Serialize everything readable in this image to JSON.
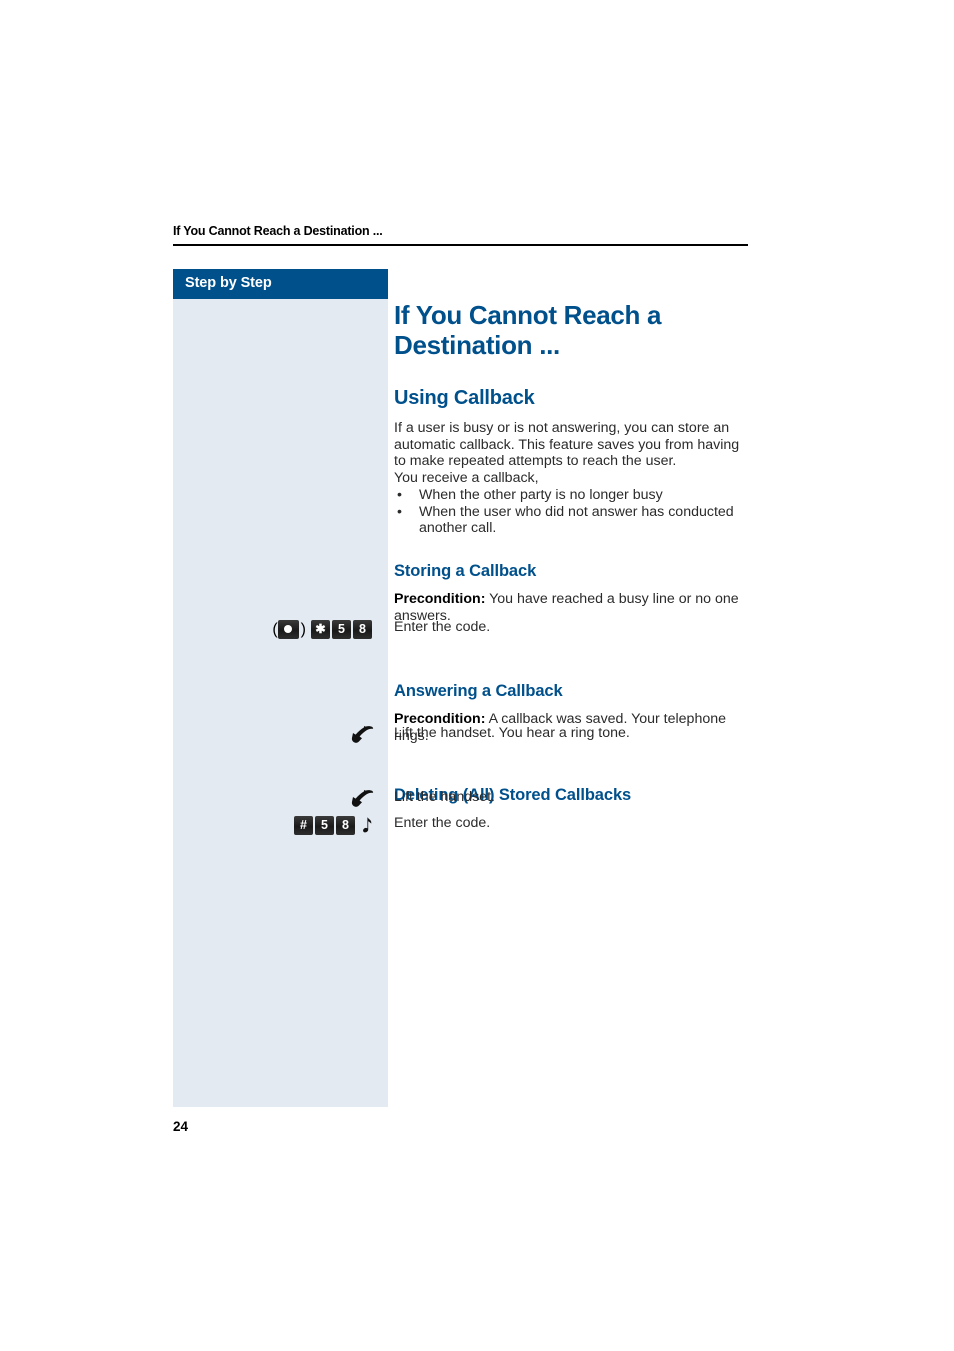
{
  "document": {
    "running_header": "If You Cannot Reach a Destination ...",
    "page_number": "24"
  },
  "side_panel": {
    "banner_label": "Step by Step"
  },
  "content": {
    "title": "If You Cannot Reach a Destination ...",
    "section_heading": "Using Callback",
    "intro_paragraph": "If a user is busy or is not answering, you can store an automatic callback. This feature saves you from having to make repeated attempts to reach the user.",
    "intro_lead_in": "You receive a callback,",
    "bullets": [
      {
        "marker": "•",
        "text": "When the other party is no longer busy"
      },
      {
        "marker": "•",
        "text": "When the user who did not answer has conducted another call."
      }
    ],
    "subsections": [
      {
        "heading": "Storing a Callback",
        "precondition_label": "Precondition:",
        "precondition_text": " You have reached a busy line or no one answers.",
        "steps": [
          {
            "icons": [
              "open-paren",
              "dot-key",
              "close-paren",
              "star-key",
              "five-key",
              "eight-key"
            ],
            "keys": {
              "star": "✱",
              "five": "5",
              "eight": "8"
            },
            "parens": {
              "open": "(",
              "close": ")"
            },
            "text": "Enter the code."
          }
        ]
      },
      {
        "heading": "Answering a Callback",
        "precondition_label": "Precondition:",
        "precondition_text": " A callback was saved. Your telephone rings.",
        "steps": [
          {
            "icons": [
              "handset"
            ],
            "text": "Lift the handset. You hear a ring tone."
          }
        ]
      },
      {
        "heading": "Deleting (All) Stored Callbacks",
        "steps": [
          {
            "icons": [
              "handset"
            ],
            "text": "Lift the handset."
          },
          {
            "icons": [
              "hash-key",
              "five-key",
              "eight-key",
              "note"
            ],
            "keys": {
              "hash": "#",
              "five": "5",
              "eight": "8"
            },
            "text": "Enter the code."
          }
        ]
      }
    ]
  },
  "colors": {
    "brand_blue": "#00508c",
    "panel_background": "#e4eaf2",
    "body_text": "#2b2b2b",
    "key_cap": "#1c1c1c"
  }
}
